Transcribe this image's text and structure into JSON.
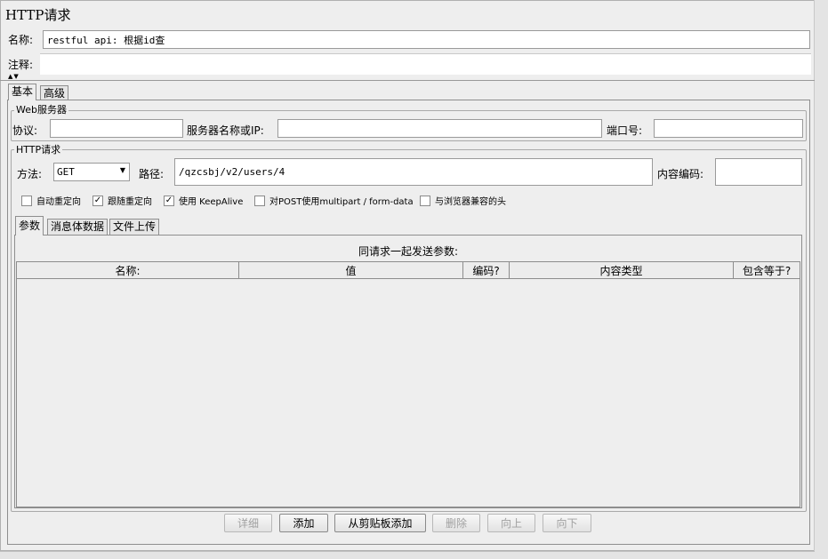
{
  "panel": {
    "title": "HTTP请求"
  },
  "name_row": {
    "label": "名称:",
    "value": "restful api: 根据id查"
  },
  "comment_row": {
    "label": "注释:",
    "value": ""
  },
  "tabs": [
    {
      "label": "基本"
    },
    {
      "label": "高级"
    }
  ],
  "web_server": {
    "title": "Web服务器",
    "protocol_label": "协议:",
    "protocol_value": "",
    "server_label": "服务器名称或IP:",
    "server_value": "",
    "port_label": "端口号:",
    "port_value": ""
  },
  "http_request": {
    "title": "HTTP请求",
    "method_label": "方法:",
    "method_value": "GET",
    "path_label": "路径:",
    "path_value": "/qzcsbj/v2/users/4",
    "encoding_label": "内容编码:",
    "encoding_value": "",
    "checkboxes": [
      {
        "label": "自动重定向",
        "checked": false
      },
      {
        "label": "跟随重定向",
        "checked": true
      },
      {
        "label": "使用 KeepAlive",
        "checked": true
      },
      {
        "label": "对POST使用multipart / form-data",
        "checked": false
      },
      {
        "label": "与浏览器兼容的头",
        "checked": false
      }
    ]
  },
  "sub_tabs": [
    {
      "label": "参数"
    },
    {
      "label": "消息体数据"
    },
    {
      "label": "文件上传"
    }
  ],
  "params": {
    "caption": "同请求一起发送参数:",
    "columns": [
      "名称:",
      "值",
      "编码?",
      "内容类型",
      "包含等于?"
    ]
  },
  "buttons": [
    {
      "label": "详细",
      "enabled": false
    },
    {
      "label": "添加",
      "enabled": true
    },
    {
      "label": "从剪贴板添加",
      "enabled": true
    },
    {
      "label": "删除",
      "enabled": false
    },
    {
      "label": "向上",
      "enabled": false
    },
    {
      "label": "向下",
      "enabled": false
    }
  ],
  "colors": {
    "background": "#eeeeee",
    "border": "#8e8e8e",
    "field": "#ffffff"
  },
  "icons": {
    "check": "check-icon",
    "dropdown": "dropdown-arrow-icon",
    "splitter": "splitter-arrows-icon"
  }
}
